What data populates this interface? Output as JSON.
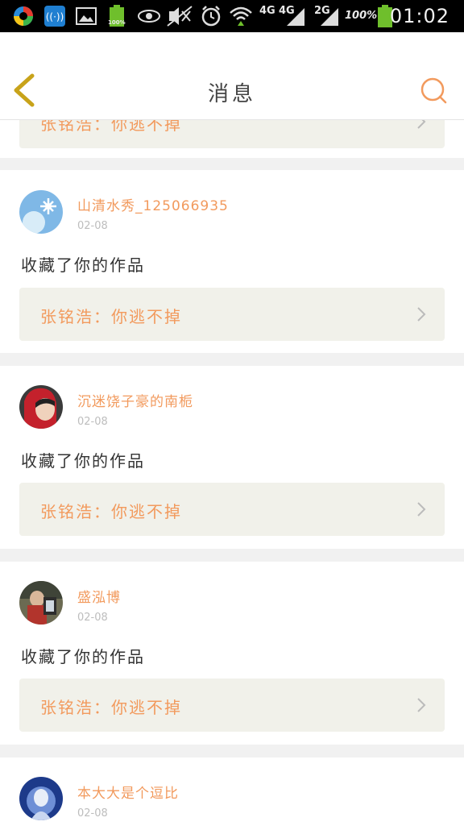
{
  "status_bar": {
    "network_4g_a": "4G",
    "network_4g_b": "4G",
    "network_2g": "2G",
    "battery_percent": "100%",
    "battery_small": "100%",
    "time": "01:02"
  },
  "header": {
    "title": "消息",
    "back_icon": "chevron-left-icon",
    "search_icon": "search-icon"
  },
  "colors": {
    "accent": "#f29a5d",
    "back": "#c8a31a",
    "link_bg": "#f1f1ea",
    "divider": "#f1f1f1"
  },
  "partial_top": {
    "work_label": "张铭浩：你逃不掉"
  },
  "messages": [
    {
      "username": "山清水秀_125066935",
      "date": "02-08",
      "action": "收藏了你的作品",
      "work_label": "张铭浩：你逃不掉"
    },
    {
      "username": "沉迷饶子豪的南栀",
      "date": "02-08",
      "action": "收藏了你的作品",
      "work_label": "张铭浩：你逃不掉"
    },
    {
      "username": "盛泓博",
      "date": "02-08",
      "action": "收藏了你的作品",
      "work_label": "张铭浩：你逃不掉"
    },
    {
      "username": "本大大是个逗比",
      "date": "02-08"
    }
  ]
}
